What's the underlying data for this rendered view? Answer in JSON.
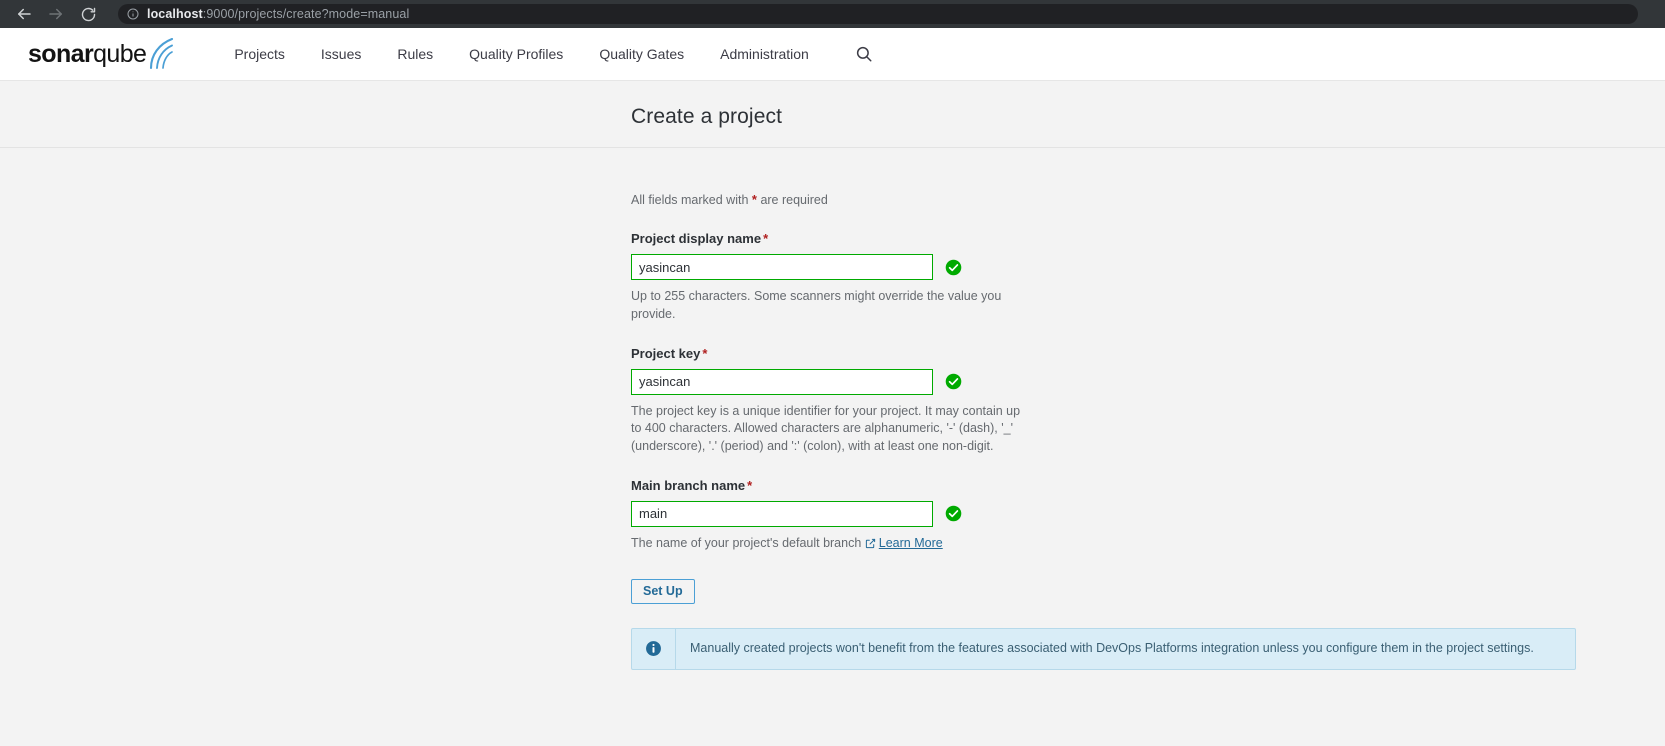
{
  "browser": {
    "back_icon": "arrow-left-icon",
    "forward_icon": "arrow-right-icon",
    "reload_icon": "reload-icon",
    "info_icon": "site-info-icon",
    "url_host": "localhost",
    "url_rest": ":9000/projects/create?mode=manual"
  },
  "navbar": {
    "logo": {
      "bold": "sonar",
      "normal": "qube",
      "icon": "sonarqube-waves-icon"
    },
    "items": [
      {
        "label": "Projects"
      },
      {
        "label": "Issues"
      },
      {
        "label": "Rules"
      },
      {
        "label": "Quality Profiles"
      },
      {
        "label": "Quality Gates"
      },
      {
        "label": "Administration"
      }
    ],
    "search_icon": "search-icon"
  },
  "page": {
    "title": "Create a project",
    "required_note_prefix": "All fields marked with",
    "required_star": "*",
    "required_note_suffix": "are required"
  },
  "form": {
    "fields": [
      {
        "label": "Project display name",
        "required_star": "*",
        "value": "yasincan",
        "help": "Up to 255 characters. Some scanners might override the value you provide.",
        "valid_icon": "check-circle-icon"
      },
      {
        "label": "Project key",
        "required_star": "*",
        "value": "yasincan",
        "help": "The project key is a unique identifier for your project. It may contain up to 400 characters. Allowed characters are alphanumeric, '-' (dash), '_' (underscore), '.' (period) and ':' (colon), with at least one non-digit.",
        "valid_icon": "check-circle-icon"
      },
      {
        "label": "Main branch name",
        "required_star": "*",
        "value": "main",
        "help": "The name of your project's default branch",
        "link_label": "Learn More",
        "link_icon": "external-link-icon",
        "valid_icon": "check-circle-icon"
      }
    ],
    "submit_label": "Set Up"
  },
  "banner": {
    "icon": "info-circle-icon",
    "text": "Manually created projects won't benefit from the features associated with DevOps Platforms integration unless you configure them in the project settings."
  },
  "colors": {
    "valid_green": "#00aa00",
    "link_blue": "#236a97",
    "banner_bg": "#d9edf7",
    "required_red": "#b02020"
  }
}
